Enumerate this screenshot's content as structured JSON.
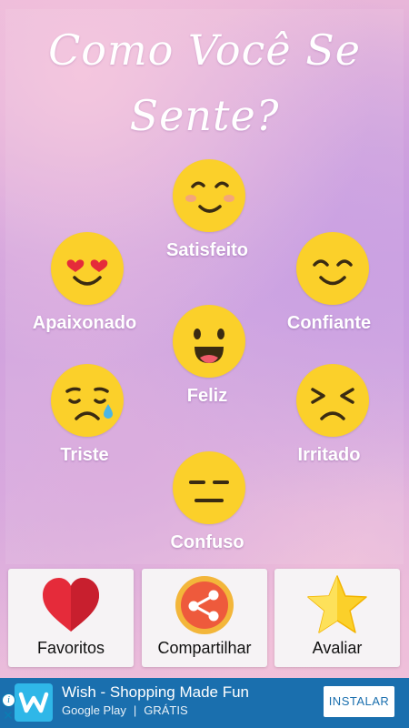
{
  "title": {
    "line1": "Como Você Se",
    "line2": "Sente?"
  },
  "emotions": [
    {
      "label": "Satisfeito",
      "icon": "satisfied-face-icon"
    },
    {
      "label": "Apaixonado",
      "icon": "heart-eyes-face-icon"
    },
    {
      "label": "Confiante",
      "icon": "smiling-face-icon"
    },
    {
      "label": "Feliz",
      "icon": "laughing-face-icon"
    },
    {
      "label": "Triste",
      "icon": "crying-face-icon"
    },
    {
      "label": "Irritado",
      "icon": "angry-face-icon"
    },
    {
      "label": "Confuso",
      "icon": "neutral-face-icon"
    }
  ],
  "actions": [
    {
      "label": "Favoritos",
      "icon": "heart-icon"
    },
    {
      "label": "Compartilhar",
      "icon": "share-icon"
    },
    {
      "label": "Avaliar",
      "icon": "star-icon"
    }
  ],
  "ad": {
    "title": "Wish - Shopping Made Fun",
    "store": "Google Play",
    "price": "GRÁTIS",
    "button": "INSTALAR",
    "info_glyph": "i",
    "close_glyph": "✕"
  },
  "colors": {
    "emoji": "#fbd02a",
    "heart": "#e52b3a",
    "share_bg": "#ee5a3c",
    "star": "#fbd02a",
    "ad_bg": "#1a6fae"
  }
}
